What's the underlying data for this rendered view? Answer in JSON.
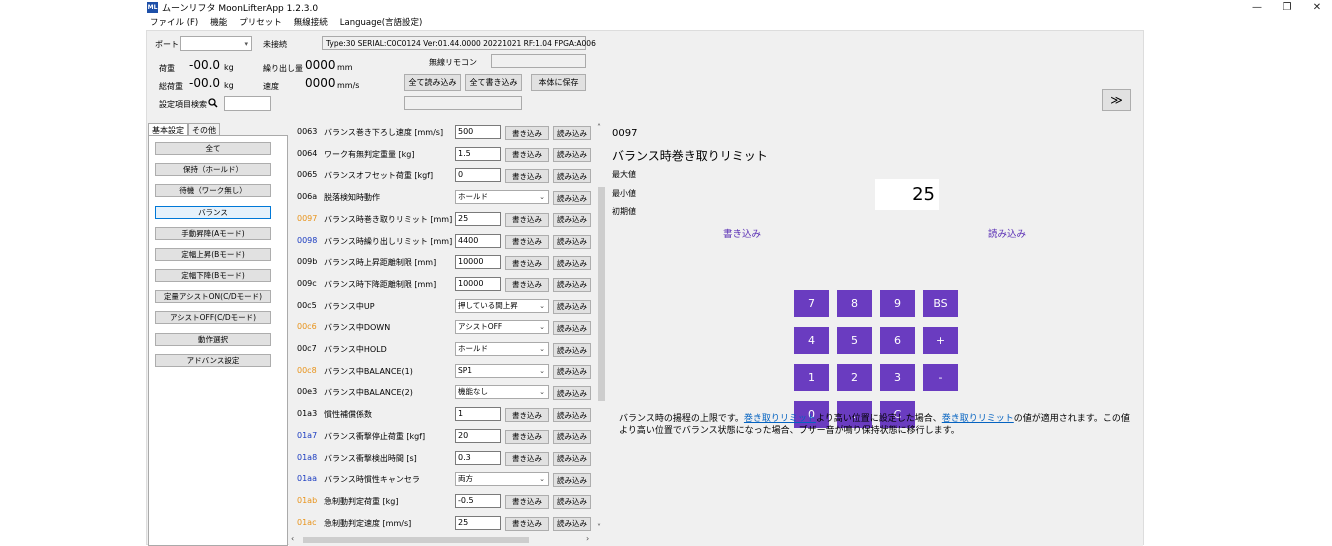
{
  "window": {
    "app_icon": "ML",
    "title": "ムーンリフタ MoonLifterApp 1.2.3.0",
    "controls": {
      "minimize": "—",
      "maximize": "❐",
      "close": "✕"
    }
  },
  "menu": [
    "ファイル (F)",
    "機能",
    "プリセット",
    "無線接続",
    "Language(言語設定)"
  ],
  "header": {
    "port_label": "ポート",
    "port_value": "",
    "connection_status": "未接続",
    "device_info": "Type:30 SERIAL:C0C0124 Ver:01.44.0000  20221021  RF:1.04  FPGA:A006",
    "load_label": "荷重",
    "load_value": "-00.0",
    "load_unit": "kg",
    "total_load_label": "総荷重",
    "total_load_value": "-00.0",
    "total_load_unit": "kg",
    "extension_label": "繰り出し量",
    "extension_value": "0000",
    "extension_unit": "mm",
    "speed_label": "速度",
    "speed_value": "0000",
    "speed_unit": "mm/s",
    "remote_label": "無線リモコン",
    "remote_value": "",
    "read_all": "全て読み込み",
    "write_all": "全て書き込み",
    "save_to_device": "本体に保存",
    "search_label": "設定項目検索",
    "search_value": "",
    "expand_button": "≫"
  },
  "tabs": [
    "基本設定",
    "その他"
  ],
  "categories": [
    "全て",
    "保持（ホールド）",
    "待機（ワーク無し）",
    "バランス",
    "手動昇降(Aモード)",
    "定幅上昇(Bモード)",
    "定幅下降(Bモード)",
    "定量アシストON(C/Dモード)",
    "アシストOFF(C/Dモード)",
    "動作選択",
    "アドバンス設定"
  ],
  "params": {
    "write_label": "書き込み",
    "read_label": "読み込み",
    "colors": {
      "normal": "#000000",
      "blue": "#1a3bc0",
      "orange": "#e8931a"
    },
    "rows": [
      {
        "code": "0063",
        "name": "バランス巻き下ろし速度 [mm/s]",
        "value": "500",
        "type": "text",
        "color": "#000000"
      },
      {
        "code": "0064",
        "name": "ワーク有無判定重量 [kg]",
        "value": "1.5",
        "type": "text",
        "color": "#000000"
      },
      {
        "code": "0065",
        "name": "バランスオフセット荷重 [kgf]",
        "value": "0",
        "type": "text",
        "color": "#000000"
      },
      {
        "code": "006a",
        "name": "脱落検知時動作",
        "value": "ホールド",
        "type": "select",
        "color": "#000000"
      },
      {
        "code": "0097",
        "name": "バランス時巻き取りリミット [mm]",
        "value": "25",
        "type": "text",
        "color": "#e8931a"
      },
      {
        "code": "0098",
        "name": "バランス時繰り出しリミット [mm]",
        "value": "4400",
        "type": "text",
        "color": "#1a3bc0"
      },
      {
        "code": "009b",
        "name": "バランス時上昇距離制限 [mm]",
        "value": "10000",
        "type": "text",
        "color": "#000000"
      },
      {
        "code": "009c",
        "name": "バランス時下降距離制限 [mm]",
        "value": "10000",
        "type": "text",
        "color": "#000000"
      },
      {
        "code": "00c5",
        "name": "バランス中UP",
        "value": "押している間上昇",
        "type": "select",
        "color": "#000000"
      },
      {
        "code": "00c6",
        "name": "バランス中DOWN",
        "value": "アシストOFF",
        "type": "select",
        "color": "#e8931a"
      },
      {
        "code": "00c7",
        "name": "バランス中HOLD",
        "value": "ホールド",
        "type": "select",
        "color": "#000000"
      },
      {
        "code": "00c8",
        "name": "バランス中BALANCE(1)",
        "value": "SP1",
        "type": "select",
        "color": "#e8931a"
      },
      {
        "code": "00e3",
        "name": "バランス中BALANCE(2)",
        "value": "機能なし",
        "type": "select",
        "color": "#000000"
      },
      {
        "code": "01a3",
        "name": "慣性補償係数",
        "value": "1",
        "type": "text",
        "color": "#000000"
      },
      {
        "code": "01a7",
        "name": "バランス衝撃停止荷重 [kgf]",
        "value": "20",
        "type": "text",
        "color": "#1a3bc0"
      },
      {
        "code": "01a8",
        "name": "バランス衝撃検出時間 [s]",
        "value": "0.3",
        "type": "text",
        "color": "#1a3bc0"
      },
      {
        "code": "01aa",
        "name": "バランス時慣性キャンセラ",
        "value": "両方",
        "type": "select",
        "color": "#1a3bc0"
      },
      {
        "code": "01ab",
        "name": "急制動判定荷重 [kg]",
        "value": "-0.5",
        "type": "text",
        "color": "#e8931a"
      },
      {
        "code": "01ac",
        "name": "急制動判定速度 [mm/s]",
        "value": "25",
        "type": "text",
        "color": "#e8931a"
      }
    ]
  },
  "detail": {
    "code": "0097",
    "title": "バランス時巻き取りリミット",
    "max_label": "最大値",
    "min_label": "最小値",
    "initial_label": "初期値",
    "value": "25",
    "write": "書き込み",
    "read": "読み込み",
    "keys": [
      [
        "7",
        "8",
        "9",
        "BS"
      ],
      [
        "4",
        "5",
        "6",
        "+"
      ],
      [
        "1",
        "2",
        "3",
        "-"
      ],
      [
        "0",
        ".",
        "C"
      ]
    ],
    "key_color": "#6a3cc0",
    "desc_parts": [
      {
        "text": "バランス時の揚程の上限です。",
        "link": false
      },
      {
        "text": "巻き取りリミット",
        "link": true
      },
      {
        "text": "より高い位置に設定した場合、",
        "link": false
      },
      {
        "text": "巻き取りリミット",
        "link": true
      },
      {
        "text": "の値が適用されます。この値より高い位置でバランス状態になった場合、ブザー音が鳴り保持状態に移行します。",
        "link": false
      }
    ]
  }
}
